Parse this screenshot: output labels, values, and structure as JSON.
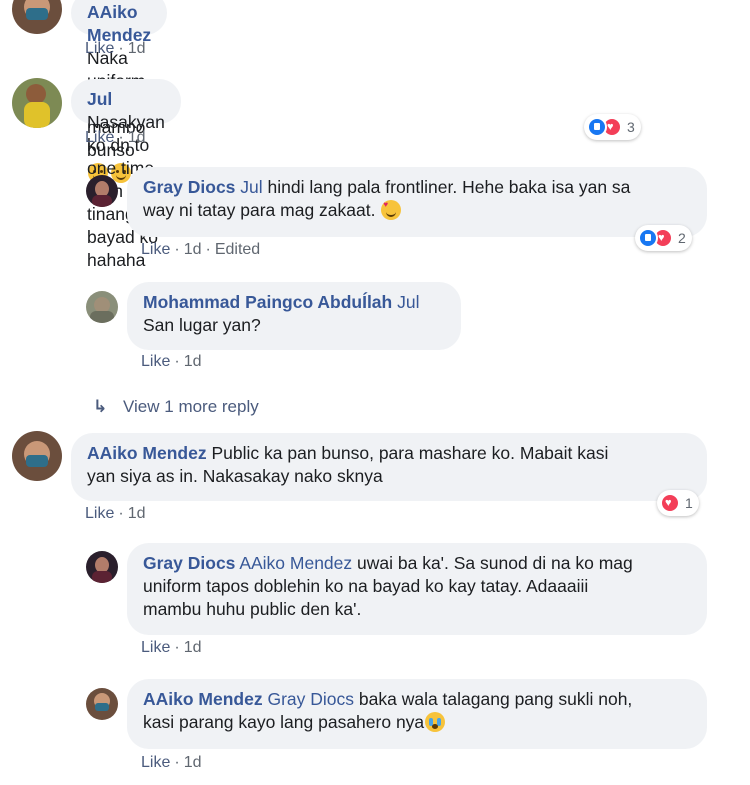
{
  "comments": [
    {
      "author": "AAiko Mendez",
      "mention": "",
      "text": "Naka uniform kabes mambo bunso",
      "emojis": [
        "smile-emoji",
        "smile-emoji"
      ],
      "actions": {
        "like": "Like",
        "time": "1d",
        "edited": ""
      },
      "reactions": null
    },
    {
      "author": "Jul",
      "mention": "",
      "text": "Nasakyan ko dn to one time. Dirin tinanggp bayad ko hahaha",
      "actions": {
        "like": "Like",
        "time": "1d",
        "edited": ""
      },
      "reactions": {
        "types": [
          "like-reaction",
          "love-reaction"
        ],
        "count": "3"
      },
      "replies": [
        {
          "author": "Gray Diocs",
          "mention": "Jul",
          "text_line1": " hindi lang pala frontliner. Hehe baka isa yan sa",
          "text_line2": "way ni tatay para mag zakaat.",
          "emojis": [
            "smiling-face-with-hearts-emoji"
          ],
          "actions": {
            "like": "Like",
            "time": "1d",
            "edited": "Edited"
          },
          "reactions": {
            "types": [
              "like-reaction",
              "love-reaction"
            ],
            "count": "2"
          }
        },
        {
          "author": "Mohammad Paingco AbduÍlah",
          "mention": "Jul",
          "text_line2": "San lugar yan?",
          "actions": {
            "like": "Like",
            "time": "1d",
            "edited": ""
          }
        }
      ],
      "view_more": "View 1 more reply"
    },
    {
      "author": "AAiko Mendez",
      "mention": "",
      "text_line1": "Public ka pan bunso, para mashare ko. Mabait kasi",
      "text_line2": "yan siya as in. Nakasakay nako sknya",
      "actions": {
        "like": "Like",
        "time": "1d",
        "edited": ""
      },
      "reactions": {
        "types": [
          "love-reaction"
        ],
        "count": "1"
      },
      "replies": [
        {
          "author": "Gray Diocs",
          "mention": "AAiko Mendez",
          "text_line1": " uwai ba ka'. Sa sunod di na ko mag",
          "text_line2": "uniform tapos doblehin ko na bayad ko kay tatay. Adaaaiii",
          "text_line3": "mambu huhu public den ka'.",
          "actions": {
            "like": "Like",
            "time": "1d",
            "edited": ""
          }
        },
        {
          "author": "AAiko Mendez",
          "mention": "Gray Diocs",
          "text_line1": " baka wala talagang pang sukli noh,",
          "text_line2": "kasi parang kayo lang pasahero nya",
          "emojis": [
            "crying-face-emoji"
          ],
          "actions": {
            "like": "Like",
            "time": "1d",
            "edited": ""
          }
        }
      ]
    }
  ],
  "colors": {
    "author": "#385898",
    "bubble": "#f0f2f5",
    "meta": "#606770",
    "like_reaction": "#1877f2",
    "love_reaction": "#f33e58"
  }
}
